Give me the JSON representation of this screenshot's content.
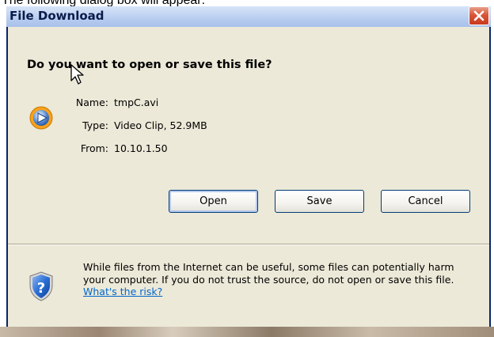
{
  "caption": "The following dialog box will appear:",
  "dialog": {
    "title": "File Download",
    "question": "Do you want to open or save this file?",
    "file_info": {
      "name_label": "Name:",
      "name_value": "tmpC.avi",
      "type_label": "Type:",
      "type_value": "Video Clip, 52.9MB",
      "from_label": "From:",
      "from_value": "10.10.1.50"
    },
    "buttons": {
      "open": "Open",
      "save": "Save",
      "cancel": "Cancel"
    },
    "warning": {
      "text": "While files from the Internet can be useful, some files can potentially harm your computer. If you do not trust the source, do not open or save this file.",
      "link": "What's the risk?"
    }
  },
  "icons": {
    "file": "media-player-icon",
    "shield": "security-shield-icon",
    "close": "close-icon",
    "cursor": "mouse-cursor-icon"
  },
  "colors": {
    "dialog_bg": "#ece9d8",
    "titlebar": "#b3c9ee",
    "close_button": "#d8553a",
    "link": "#0066cc",
    "shield": "#1a5fc4"
  }
}
